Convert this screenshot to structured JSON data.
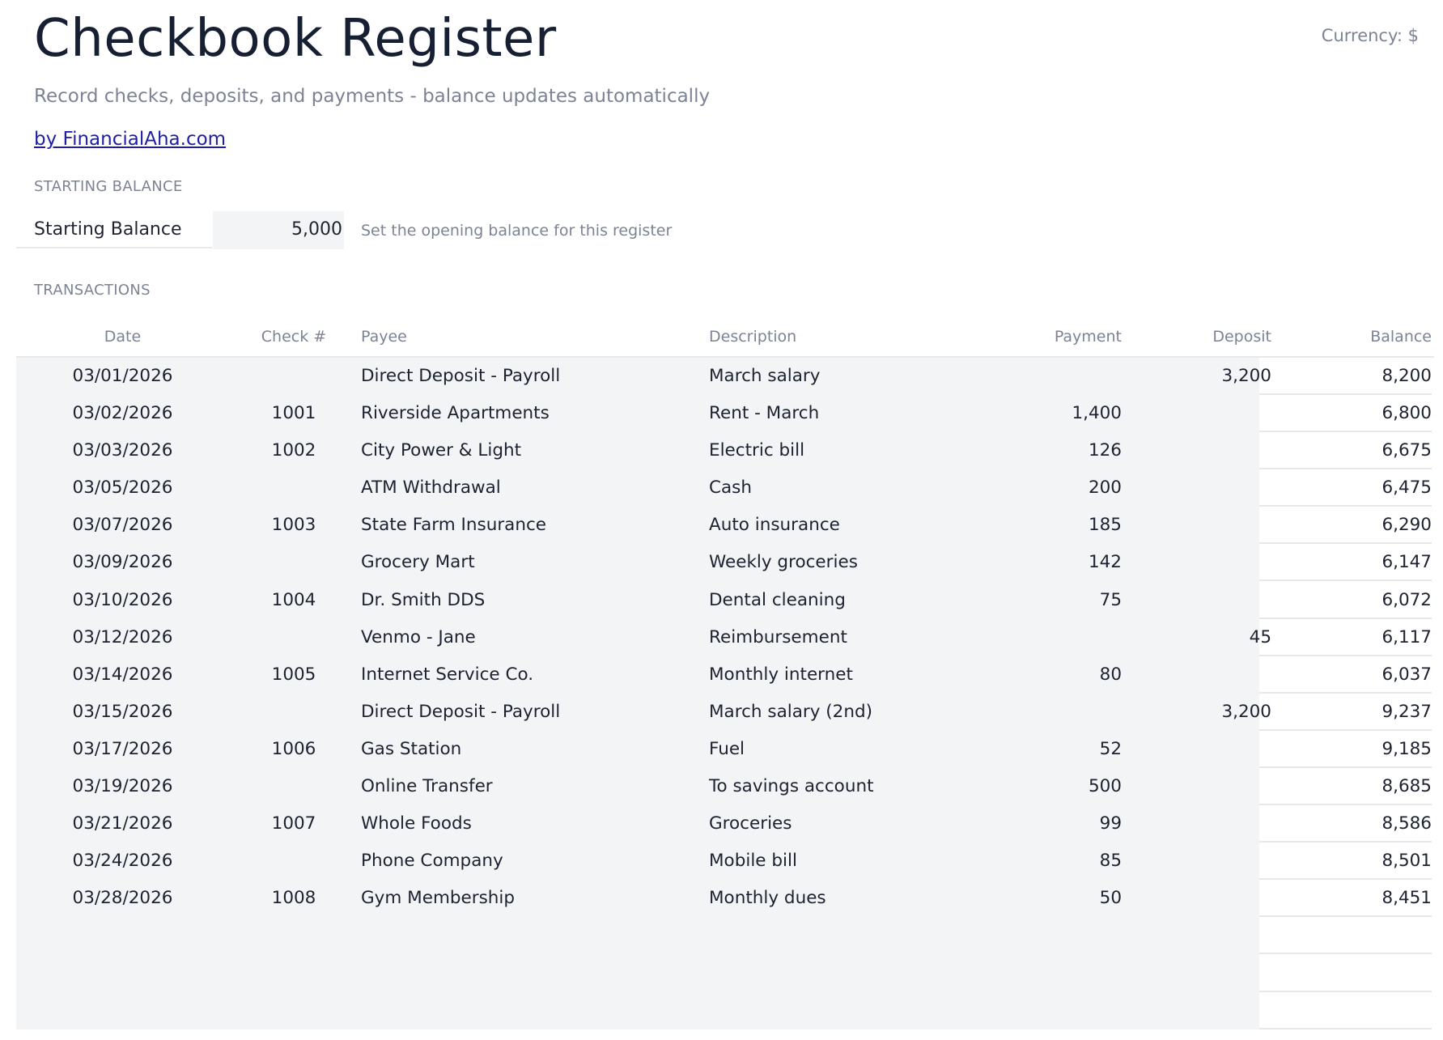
{
  "header": {
    "title": "Checkbook Register",
    "currency": "Currency: $",
    "subtitle": "Record checks, deposits, and payments - balance updates automatically",
    "byline": "by FinancialAha.com"
  },
  "starting_balance": {
    "section_label": "STARTING BALANCE",
    "label": "Starting Balance",
    "value": "5,000",
    "hint": "Set the opening balance for this register"
  },
  "transactions": {
    "section_label": "TRANSACTIONS",
    "columns": [
      "Date",
      "Check #",
      "Payee",
      "Description",
      "Payment",
      "Deposit",
      "Balance"
    ],
    "rows": [
      {
        "date": "03/01/2026",
        "check": "",
        "payee": "Direct Deposit - Payroll",
        "description": "March salary",
        "payment": "",
        "deposit": "3,200",
        "balance": "8,200"
      },
      {
        "date": "03/02/2026",
        "check": "1001",
        "payee": "Riverside Apartments",
        "description": "Rent - March",
        "payment": "1,400",
        "deposit": "",
        "balance": "6,800"
      },
      {
        "date": "03/03/2026",
        "check": "1002",
        "payee": "City Power & Light",
        "description": "Electric bill",
        "payment": "126",
        "deposit": "",
        "balance": "6,675"
      },
      {
        "date": "03/05/2026",
        "check": "",
        "payee": "ATM Withdrawal",
        "description": "Cash",
        "payment": "200",
        "deposit": "",
        "balance": "6,475"
      },
      {
        "date": "03/07/2026",
        "check": "1003",
        "payee": "State Farm Insurance",
        "description": "Auto insurance",
        "payment": "185",
        "deposit": "",
        "balance": "6,290"
      },
      {
        "date": "03/09/2026",
        "check": "",
        "payee": "Grocery Mart",
        "description": "Weekly groceries",
        "payment": "142",
        "deposit": "",
        "balance": "6,147"
      },
      {
        "date": "03/10/2026",
        "check": "1004",
        "payee": "Dr. Smith DDS",
        "description": "Dental cleaning",
        "payment": "75",
        "deposit": "",
        "balance": "6,072"
      },
      {
        "date": "03/12/2026",
        "check": "",
        "payee": "Venmo - Jane",
        "description": "Reimbursement",
        "payment": "",
        "deposit": "45",
        "balance": "6,117"
      },
      {
        "date": "03/14/2026",
        "check": "1005",
        "payee": "Internet Service Co.",
        "description": "Monthly internet",
        "payment": "80",
        "deposit": "",
        "balance": "6,037"
      },
      {
        "date": "03/15/2026",
        "check": "",
        "payee": "Direct Deposit - Payroll",
        "description": "March salary (2nd)",
        "payment": "",
        "deposit": "3,200",
        "balance": "9,237"
      },
      {
        "date": "03/17/2026",
        "check": "1006",
        "payee": "Gas Station",
        "description": "Fuel",
        "payment": "52",
        "deposit": "",
        "balance": "9,185"
      },
      {
        "date": "03/19/2026",
        "check": "",
        "payee": "Online Transfer",
        "description": "To savings account",
        "payment": "500",
        "deposit": "",
        "balance": "8,685"
      },
      {
        "date": "03/21/2026",
        "check": "1007",
        "payee": "Whole Foods",
        "description": "Groceries",
        "payment": "99",
        "deposit": "",
        "balance": "8,586"
      },
      {
        "date": "03/24/2026",
        "check": "",
        "payee": "Phone Company",
        "description": "Mobile bill",
        "payment": "85",
        "deposit": "",
        "balance": "8,501"
      },
      {
        "date": "03/28/2026",
        "check": "1008",
        "payee": "Gym Membership",
        "description": "Monthly dues",
        "payment": "50",
        "deposit": "",
        "balance": "8,451"
      },
      {
        "date": "",
        "check": "",
        "payee": "",
        "description": "",
        "payment": "",
        "deposit": "",
        "balance": ""
      },
      {
        "date": "",
        "check": "",
        "payee": "",
        "description": "",
        "payment": "",
        "deposit": "",
        "balance": ""
      },
      {
        "date": "",
        "check": "",
        "payee": "",
        "description": "",
        "payment": "",
        "deposit": "",
        "balance": ""
      }
    ]
  }
}
